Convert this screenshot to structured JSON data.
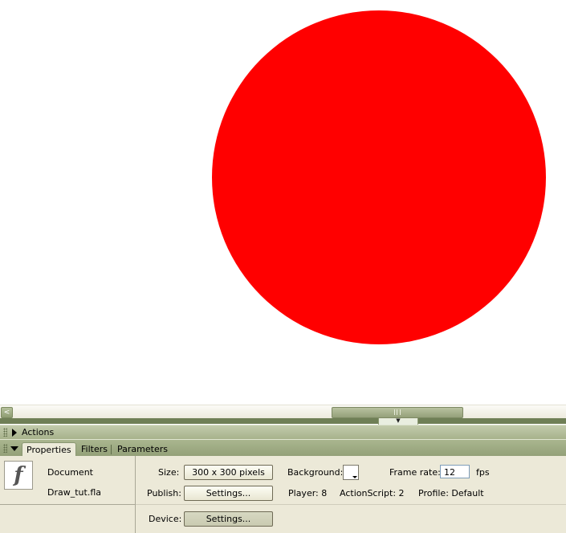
{
  "stage": {
    "shape_color": "#ff0000",
    "background": "#ffffff"
  },
  "scrollbar": {
    "left_arrow": "<"
  },
  "actions_panel": {
    "title": "Actions"
  },
  "properties_panel": {
    "tabs": [
      "Properties",
      "Filters",
      "Parameters"
    ],
    "active_tab": "Properties",
    "document_label": "Document",
    "file_name": "Draw_tut.fla",
    "size_label": "Size:",
    "size_value": "300 x 300 pixels",
    "background_label": "Background:",
    "background_color": "#ffffff",
    "frame_rate_label": "Frame rate:",
    "frame_rate_value": "12",
    "fps_label": "fps",
    "publish_label": "Publish:",
    "publish_settings_label": "Settings...",
    "player_text": "Player: 8",
    "actionscript_text": "ActionScript: 2",
    "profile_text": "Profile: Default",
    "device_label": "Device:",
    "device_settings_label": "Settings..."
  },
  "icons": {
    "flash_doc": "f"
  },
  "colors": {
    "panel_accent": "#a7b28b",
    "stage_circle": "#ff0000"
  }
}
